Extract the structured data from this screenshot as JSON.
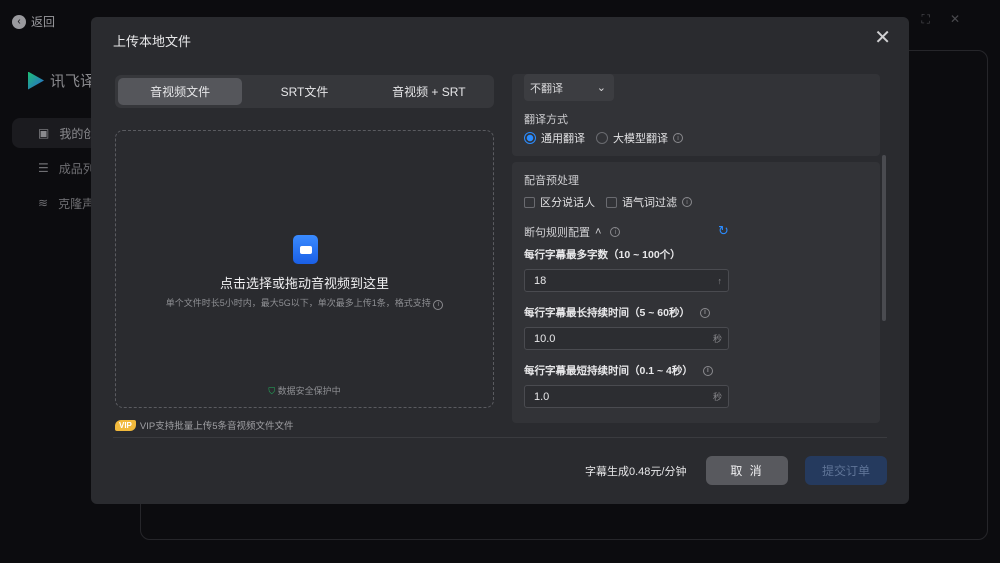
{
  "background": {
    "back_label": "返回",
    "logo_text": "讯飞译",
    "sidebar": [
      {
        "label": "我的创",
        "icon": "folder-icon"
      },
      {
        "label": "成品列",
        "icon": "list-icon"
      },
      {
        "label": "克隆声",
        "icon": "waveform-icon"
      }
    ]
  },
  "modal": {
    "title": "上传本地文件",
    "tabs": [
      {
        "label": "音视频文件",
        "active": true
      },
      {
        "label": "SRT文件"
      },
      {
        "label": "音视频 + SRT"
      }
    ],
    "drop": {
      "main": "点击选择或拖动音视频到这里",
      "sub": "单个文件时长5小时内，最大5G以下，单次最多上传1条，格式支持",
      "safe": "数据安全保护中"
    },
    "vip_badge": "VIP",
    "vip_text": "VIP支持批量上传5条音视频文件文件",
    "translate": {
      "select_value": "不翻译",
      "method_label": "翻译方式",
      "options": [
        {
          "label": "通用翻译",
          "selected": true
        },
        {
          "label": "大模型翻译",
          "selected": false
        }
      ]
    },
    "preprocess": {
      "label": "配音预处理",
      "checks": [
        {
          "label": "区分说话人",
          "checked": false
        },
        {
          "label": "语气词过滤",
          "checked": false
        }
      ]
    },
    "rules": {
      "label": "断句规则配置",
      "fields": [
        {
          "label": "每行字幕最多字数（10 ~ 100个）",
          "value": "18",
          "unit": "个"
        },
        {
          "label": "每行字幕最长持续时间（5 ~ 60秒）",
          "value": "10.0",
          "unit": "秒"
        },
        {
          "label": "每行字幕最短持续时间（0.1 ~ 4秒）",
          "value": "1.0",
          "unit": "秒"
        }
      ]
    },
    "price": "字幕生成0.48元/分钟",
    "cancel": "取 消",
    "submit": "提交订单"
  }
}
